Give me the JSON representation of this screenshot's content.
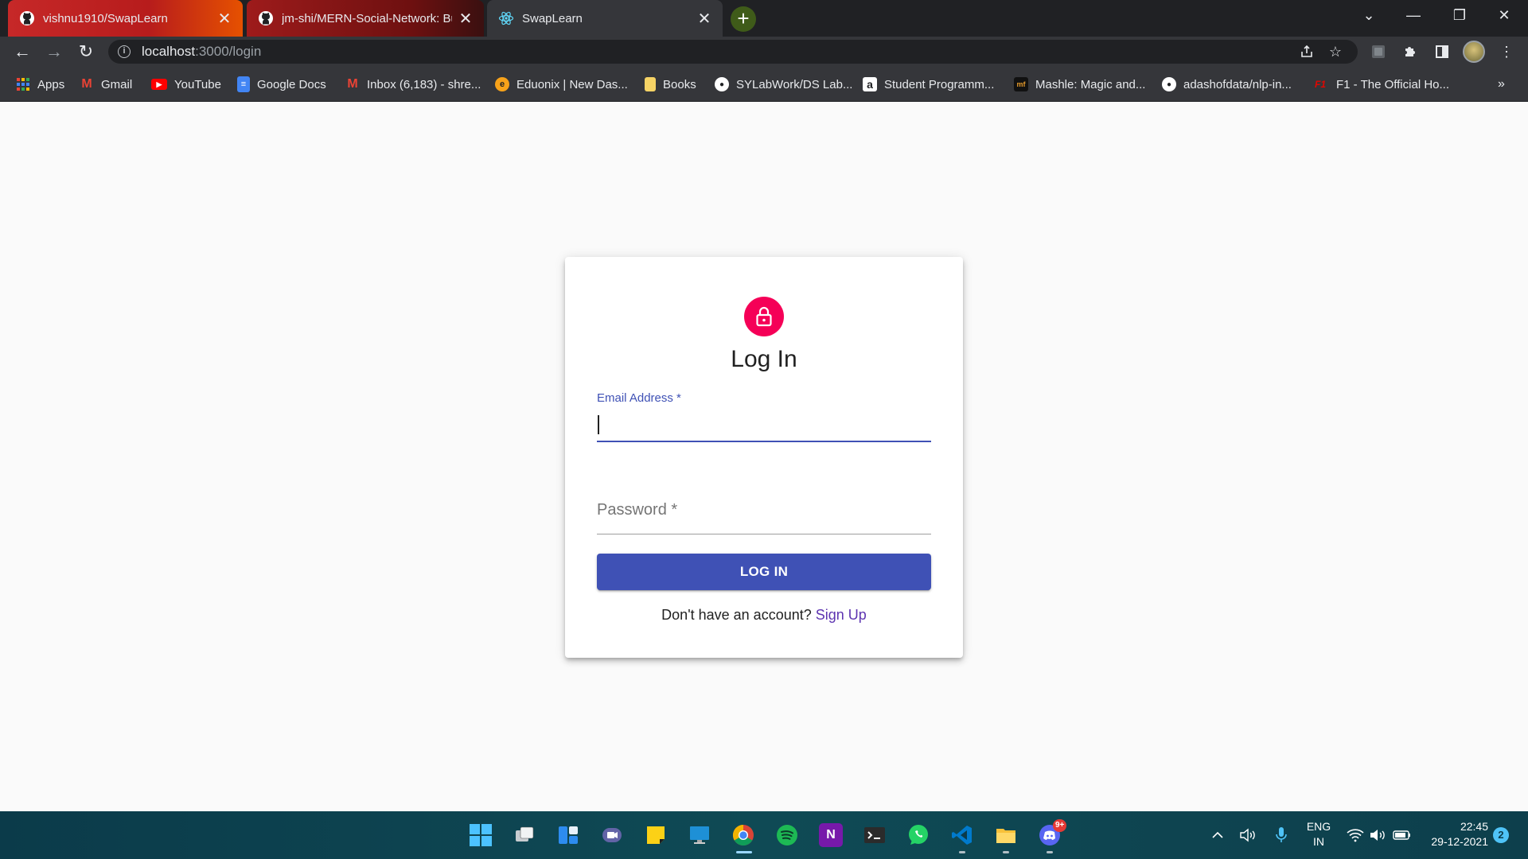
{
  "browser": {
    "tabs": [
      {
        "title": "vishnu1910/SwapLearn",
        "icon": "github-icon"
      },
      {
        "title": "jm-shi/MERN-Social-Network: Bu",
        "icon": "github-icon"
      },
      {
        "title": "SwapLearn",
        "icon": "react-icon"
      }
    ],
    "tab_close_glyph": "✕",
    "new_tab_glyph": "+",
    "window_controls": {
      "dropdown": "⌄",
      "minimize": "—",
      "restore": "❐",
      "close": "✕"
    },
    "nav": {
      "back": "←",
      "forward": "→",
      "reload": "↻"
    },
    "url": {
      "host": "localhost",
      "path": ":3000/login"
    },
    "bookmarks": [
      {
        "label": "Apps",
        "icon": "apps-grid-icon"
      },
      {
        "label": "Gmail",
        "icon": "gmail-icon"
      },
      {
        "label": "YouTube",
        "icon": "youtube-icon"
      },
      {
        "label": "Google Docs",
        "icon": "google-docs-icon"
      },
      {
        "label": "Inbox (6,183) - shre...",
        "icon": "gmail-icon"
      },
      {
        "label": "Eduonix | New Das...",
        "icon": "eduonix-icon"
      },
      {
        "label": "Books",
        "icon": "folder-icon"
      },
      {
        "label": "SYLabWork/DS Lab...",
        "icon": "github-icon"
      },
      {
        "label": "Student Programm...",
        "icon": "amazon-icon"
      },
      {
        "label": "Mashle: Magic and...",
        "icon": "manga-icon"
      },
      {
        "label": "adashofdata/nlp-in...",
        "icon": "github-icon"
      },
      {
        "label": "F1 - The Official Ho...",
        "icon": "f1-icon"
      }
    ],
    "bookmarks_more": "»"
  },
  "login": {
    "title": "Log In",
    "email_label": "Email Address *",
    "password_label": "Password *",
    "submit_label": "LOG IN",
    "signup_prompt": "Don't have an account?",
    "signup_link": "Sign Up",
    "accent_color": "#3f51b5",
    "avatar_color": "#f50057"
  },
  "taskbar": {
    "apps": [
      "windows-start-icon",
      "task-view-icon",
      "widgets-icon",
      "teams-chat-icon",
      "sticky-notes-icon",
      "remote-desktop-icon",
      "chrome-icon",
      "spotify-icon",
      "onenote-icon",
      "terminal-icon",
      "whatsapp-icon",
      "vscode-icon",
      "file-explorer-icon",
      "discord-icon"
    ],
    "discord_badge": "9+",
    "tray": {
      "language_line1": "ENG",
      "language_line2": "IN",
      "time": "22:45",
      "date": "29-12-2021",
      "notifications": "2"
    }
  }
}
